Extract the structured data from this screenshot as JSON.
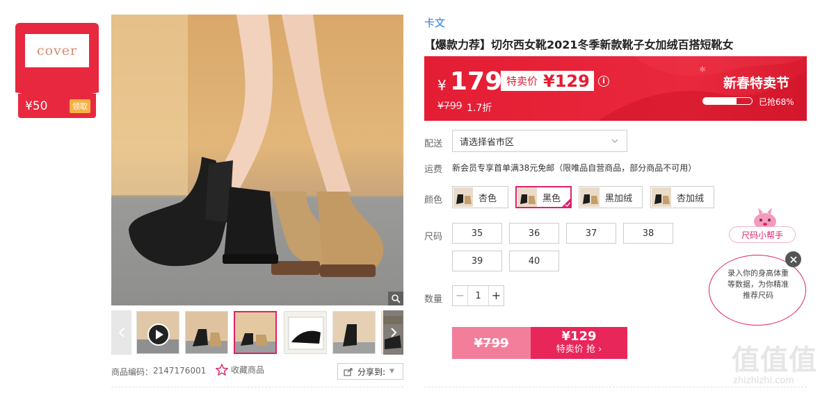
{
  "coupon": {
    "brand": "cover",
    "amount": "¥50",
    "claim_label": "领取"
  },
  "product": {
    "brand": "卡文",
    "title": "【爆款力荐】切尔西女靴2021冬季新款靴子女加绒百搭短靴女",
    "code_label": "商品编码：",
    "code": "2147176001",
    "favorite_label": "收藏商品",
    "share_label": "分享到:"
  },
  "price": {
    "currency": "¥",
    "main": "179",
    "special_label": "特卖价",
    "special_price": "¥129",
    "original": "¥799",
    "discount": "1.7折",
    "promo": "新春特卖节",
    "sold_text": "已抢68%",
    "sold_fraction": 0.68
  },
  "delivery": {
    "label": "配送",
    "placeholder": "请选择省市区"
  },
  "shipping": {
    "label": "运费",
    "text": "新会员专享首单满38元免邮（限唯品自营商品，部分商品不可用）"
  },
  "colors": {
    "label": "颜色",
    "options": [
      "杏色",
      "黑色",
      "黑加绒",
      "杏加绒"
    ],
    "selected": "黑色"
  },
  "sizes": {
    "label": "尺码",
    "options": [
      "35",
      "36",
      "37",
      "38",
      "39",
      "40"
    ]
  },
  "quantity": {
    "label": "数量",
    "value": "1",
    "minus": "−",
    "plus": "+"
  },
  "buy": {
    "original": "¥799",
    "price": "¥129",
    "action": "特卖价 抢"
  },
  "size_helper": {
    "title": "尺码小帮手",
    "text": "录入你的身高体重等数据，为你精准推荐尺码"
  },
  "watermark": {
    "logo": "值值值",
    "site": "zhizhizhi.com"
  },
  "colors_theme": {
    "accent": "#e41d33",
    "pink": "#e0206a",
    "link": "#2a7ad6"
  }
}
